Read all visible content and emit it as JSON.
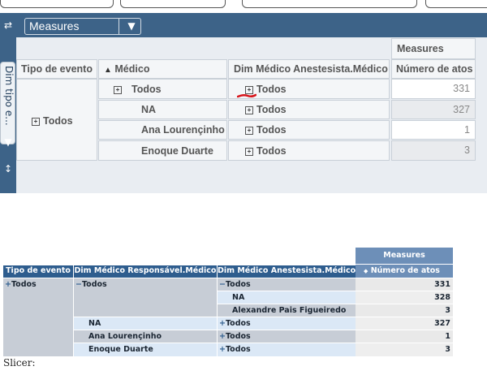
{
  "top": {
    "measures_chip_label": "Measures",
    "measures_col_header": "Measures",
    "vertical_tab": "Dim tipo e...",
    "row_headers": [
      "Tipo de evento",
      "Médico",
      "Dim Médico Anestesista.Médico",
      "Número de atos"
    ],
    "tipo_value": "Todos",
    "rows": [
      {
        "medico": "Todos",
        "anest": "Todos",
        "value": "331"
      },
      {
        "medico": "NA",
        "anest": "Todos",
        "value": "327"
      },
      {
        "medico": "Ana Lourençinho",
        "anest": "Todos",
        "value": "1"
      },
      {
        "medico": "Enoque Duarte",
        "anest": "Todos",
        "value": "3"
      }
    ]
  },
  "bottom": {
    "measures_label": "Measures",
    "headers": [
      "Tipo de evento",
      "Dim Médico Responsável.Médico",
      "Dim Médico Anestesista.Médico",
      "Número de atos"
    ],
    "tipo": "Todos",
    "rows": [
      {
        "resp": "Todos",
        "anest": "Todos",
        "value": "331"
      },
      {
        "resp": "",
        "anest": "NA",
        "value": "328"
      },
      {
        "resp": "",
        "anest": "Alexandre Pais Figueiredo",
        "value": "3"
      },
      {
        "resp": "NA",
        "anest": "Todos",
        "value": "327"
      },
      {
        "resp": "Ana Lourençinho",
        "anest": "Todos",
        "value": "1"
      },
      {
        "resp": "Enoque Duarte",
        "anest": "Todos",
        "value": "3"
      }
    ],
    "slicer_label": "Slicer:"
  },
  "colors": {
    "header_blue": "#3d6388",
    "annotation_red": "#d8141a"
  }
}
